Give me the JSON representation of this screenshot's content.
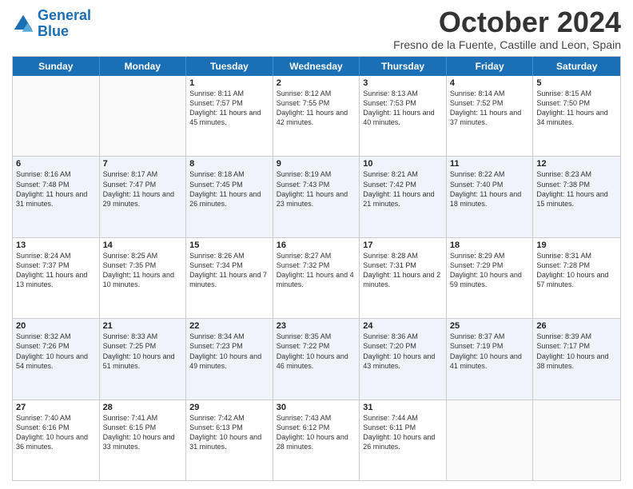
{
  "logo": {
    "line1": "General",
    "line2": "Blue"
  },
  "title": "October 2024",
  "subtitle": "Fresno de la Fuente, Castille and Leon, Spain",
  "days": [
    "Sunday",
    "Monday",
    "Tuesday",
    "Wednesday",
    "Thursday",
    "Friday",
    "Saturday"
  ],
  "rows": [
    [
      {
        "day": "",
        "info": ""
      },
      {
        "day": "",
        "info": ""
      },
      {
        "day": "1",
        "info": "Sunrise: 8:11 AM\nSunset: 7:57 PM\nDaylight: 11 hours and 45 minutes."
      },
      {
        "day": "2",
        "info": "Sunrise: 8:12 AM\nSunset: 7:55 PM\nDaylight: 11 hours and 42 minutes."
      },
      {
        "day": "3",
        "info": "Sunrise: 8:13 AM\nSunset: 7:53 PM\nDaylight: 11 hours and 40 minutes."
      },
      {
        "day": "4",
        "info": "Sunrise: 8:14 AM\nSunset: 7:52 PM\nDaylight: 11 hours and 37 minutes."
      },
      {
        "day": "5",
        "info": "Sunrise: 8:15 AM\nSunset: 7:50 PM\nDaylight: 11 hours and 34 minutes."
      }
    ],
    [
      {
        "day": "6",
        "info": "Sunrise: 8:16 AM\nSunset: 7:48 PM\nDaylight: 11 hours and 31 minutes."
      },
      {
        "day": "7",
        "info": "Sunrise: 8:17 AM\nSunset: 7:47 PM\nDaylight: 11 hours and 29 minutes."
      },
      {
        "day": "8",
        "info": "Sunrise: 8:18 AM\nSunset: 7:45 PM\nDaylight: 11 hours and 26 minutes."
      },
      {
        "day": "9",
        "info": "Sunrise: 8:19 AM\nSunset: 7:43 PM\nDaylight: 11 hours and 23 minutes."
      },
      {
        "day": "10",
        "info": "Sunrise: 8:21 AM\nSunset: 7:42 PM\nDaylight: 11 hours and 21 minutes."
      },
      {
        "day": "11",
        "info": "Sunrise: 8:22 AM\nSunset: 7:40 PM\nDaylight: 11 hours and 18 minutes."
      },
      {
        "day": "12",
        "info": "Sunrise: 8:23 AM\nSunset: 7:38 PM\nDaylight: 11 hours and 15 minutes."
      }
    ],
    [
      {
        "day": "13",
        "info": "Sunrise: 8:24 AM\nSunset: 7:37 PM\nDaylight: 11 hours and 13 minutes."
      },
      {
        "day": "14",
        "info": "Sunrise: 8:25 AM\nSunset: 7:35 PM\nDaylight: 11 hours and 10 minutes."
      },
      {
        "day": "15",
        "info": "Sunrise: 8:26 AM\nSunset: 7:34 PM\nDaylight: 11 hours and 7 minutes."
      },
      {
        "day": "16",
        "info": "Sunrise: 8:27 AM\nSunset: 7:32 PM\nDaylight: 11 hours and 4 minutes."
      },
      {
        "day": "17",
        "info": "Sunrise: 8:28 AM\nSunset: 7:31 PM\nDaylight: 11 hours and 2 minutes."
      },
      {
        "day": "18",
        "info": "Sunrise: 8:29 AM\nSunset: 7:29 PM\nDaylight: 10 hours and 59 minutes."
      },
      {
        "day": "19",
        "info": "Sunrise: 8:31 AM\nSunset: 7:28 PM\nDaylight: 10 hours and 57 minutes."
      }
    ],
    [
      {
        "day": "20",
        "info": "Sunrise: 8:32 AM\nSunset: 7:26 PM\nDaylight: 10 hours and 54 minutes."
      },
      {
        "day": "21",
        "info": "Sunrise: 8:33 AM\nSunset: 7:25 PM\nDaylight: 10 hours and 51 minutes."
      },
      {
        "day": "22",
        "info": "Sunrise: 8:34 AM\nSunset: 7:23 PM\nDaylight: 10 hours and 49 minutes."
      },
      {
        "day": "23",
        "info": "Sunrise: 8:35 AM\nSunset: 7:22 PM\nDaylight: 10 hours and 46 minutes."
      },
      {
        "day": "24",
        "info": "Sunrise: 8:36 AM\nSunset: 7:20 PM\nDaylight: 10 hours and 43 minutes."
      },
      {
        "day": "25",
        "info": "Sunrise: 8:37 AM\nSunset: 7:19 PM\nDaylight: 10 hours and 41 minutes."
      },
      {
        "day": "26",
        "info": "Sunrise: 8:39 AM\nSunset: 7:17 PM\nDaylight: 10 hours and 38 minutes."
      }
    ],
    [
      {
        "day": "27",
        "info": "Sunrise: 7:40 AM\nSunset: 6:16 PM\nDaylight: 10 hours and 36 minutes."
      },
      {
        "day": "28",
        "info": "Sunrise: 7:41 AM\nSunset: 6:15 PM\nDaylight: 10 hours and 33 minutes."
      },
      {
        "day": "29",
        "info": "Sunrise: 7:42 AM\nSunset: 6:13 PM\nDaylight: 10 hours and 31 minutes."
      },
      {
        "day": "30",
        "info": "Sunrise: 7:43 AM\nSunset: 6:12 PM\nDaylight: 10 hours and 28 minutes."
      },
      {
        "day": "31",
        "info": "Sunrise: 7:44 AM\nSunset: 6:11 PM\nDaylight: 10 hours and 26 minutes."
      },
      {
        "day": "",
        "info": ""
      },
      {
        "day": "",
        "info": ""
      }
    ]
  ]
}
